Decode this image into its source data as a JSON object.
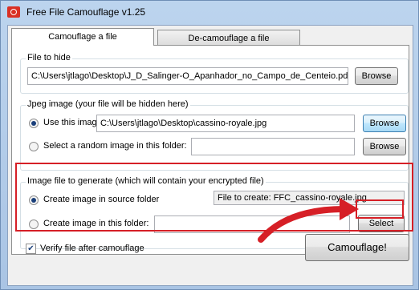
{
  "window": {
    "title": "Free File Camouflage v1.25",
    "icon": "app-icon"
  },
  "tabs": [
    {
      "label": "Camouflage a file",
      "active": true
    },
    {
      "label": "De-camouflage a file",
      "active": false
    }
  ],
  "file_to_hide": {
    "group_label": "File to hide",
    "path": "C:\\Users\\jtlago\\Desktop\\J_D_Salinger-O_Apanhador_no_Campo_de_Centeio.pdf",
    "browse_label": "Browse"
  },
  "jpeg_image": {
    "group_label": "Jpeg image (your file will be hidden here)",
    "use_this_label": "Use this image:",
    "use_this_checked": true,
    "image_path": "C:\\Users\\jtlago\\Desktop\\cassino-royale.jpg",
    "browse_label_1": "Browse",
    "random_label": "Select a random image in this folder:",
    "random_checked": false,
    "random_folder": "",
    "browse_label_2": "Browse"
  },
  "image_to_generate": {
    "group_label": "Image file to generate (which will contain your encrypted file)",
    "source_folder_label": "Create image in source folder",
    "source_folder_checked": true,
    "file_to_create": "File to create: FFC_cassino-royale.jpg",
    "this_folder_label": "Create image in this folder:",
    "this_folder_checked": false,
    "this_folder_value": "",
    "select_label": "Select"
  },
  "footer": {
    "verify_label": "Verify file after camouflage",
    "verify_checked": true,
    "camouflage_label": "Camouflage!"
  },
  "annotation": {
    "highlight_color": "#d61f26"
  }
}
